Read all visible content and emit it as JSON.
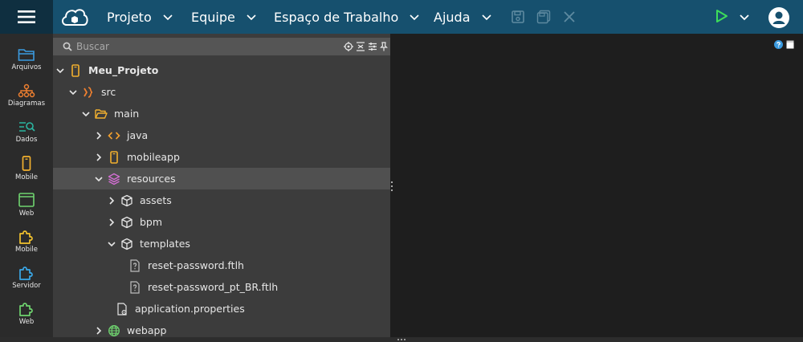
{
  "menu": {
    "items": [
      {
        "label": "Projeto"
      },
      {
        "label": "Equipe"
      },
      {
        "label": "Espaço de Trabalho"
      },
      {
        "label": "Ajuda"
      }
    ]
  },
  "sidebar": {
    "items": [
      {
        "label": "Arquivos",
        "icon": "folder-icon",
        "color": "#3b9be0"
      },
      {
        "label": "Diagramas",
        "icon": "diagram-icon",
        "color": "#f08030"
      },
      {
        "label": "Dados",
        "icon": "data-search-icon",
        "color": "#2bb5a0"
      },
      {
        "label": "Mobile",
        "icon": "mobile-icon",
        "color": "#f2b02e"
      },
      {
        "label": "Web",
        "icon": "browser-icon",
        "color": "#6fd46f"
      },
      {
        "label": "Mobile",
        "icon": "puzzle-icon",
        "color": "#f2c22e"
      },
      {
        "label": "Servidor",
        "icon": "puzzle-icon",
        "color": "#3aa8e8"
      },
      {
        "label": "Web",
        "icon": "puzzle-icon",
        "color": "#6fd46f"
      }
    ]
  },
  "explorer": {
    "search_placeholder": "Buscar",
    "tree": [
      {
        "label": "Meu_Projeto",
        "icon": "mobile-project-icon",
        "expanded": true,
        "bold": true
      },
      {
        "label": "src",
        "icon": "source-icon",
        "expanded": true
      },
      {
        "label": "main",
        "icon": "folder-open-icon",
        "expanded": true
      },
      {
        "label": "java",
        "icon": "code-icon",
        "expanded": false
      },
      {
        "label": "mobileapp",
        "icon": "mobile-icon",
        "expanded": false
      },
      {
        "label": "resources",
        "icon": "layers-icon",
        "expanded": true,
        "selected": true
      },
      {
        "label": "assets",
        "icon": "package-icon",
        "expanded": false
      },
      {
        "label": "bpm",
        "icon": "package-icon",
        "expanded": false
      },
      {
        "label": "templates",
        "icon": "package-icon",
        "expanded": true
      },
      {
        "label": "reset-password.ftlh",
        "icon": "unknown-file-icon"
      },
      {
        "label": "reset-password_pt_BR.ftlh",
        "icon": "unknown-file-icon"
      },
      {
        "label": "application.properties",
        "icon": "settings-file-icon"
      },
      {
        "label": "webapp",
        "icon": "globe-icon",
        "expanded": false
      }
    ]
  },
  "colors": {
    "topbar": "#16506e",
    "accent_play": "#3ddc5a",
    "selected_row": "#505050"
  }
}
